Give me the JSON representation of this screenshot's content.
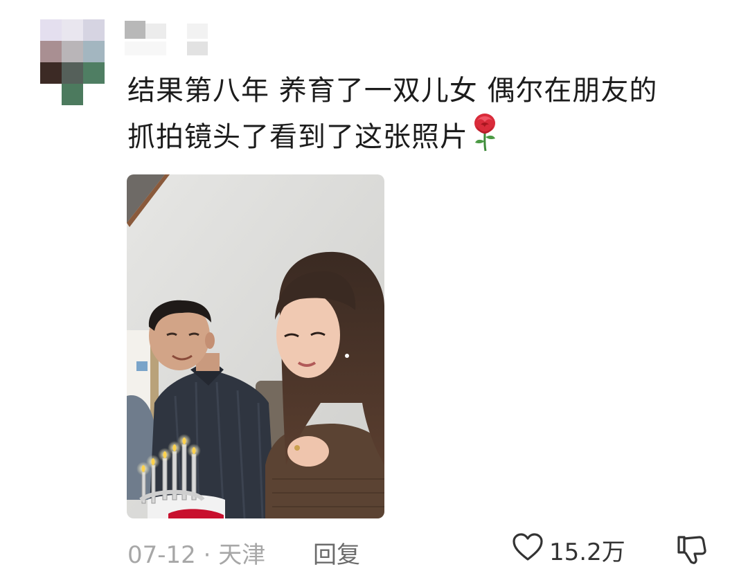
{
  "comment": {
    "username": "",
    "text_lines": [
      "结果第八年 养育了一双儿女 偶尔在朋友的",
      "抓拍镜头了看到了这张照片"
    ],
    "emoji": "rose-icon",
    "photo": {
      "alt": "photo-of-couple-with-birthday-cake"
    },
    "date": "07-12",
    "separator": "·",
    "location": "天津",
    "reply_label": "回复",
    "like_count": "15.2万"
  },
  "colors": {
    "text": "#1c1c1c",
    "meta": "#a7a7a7",
    "reply": "#6b6b6b"
  }
}
